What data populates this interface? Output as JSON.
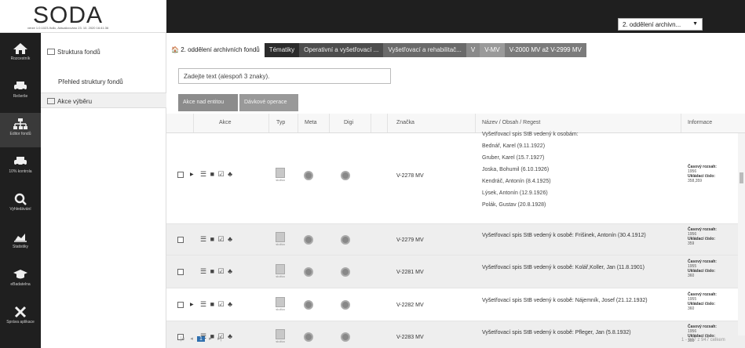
{
  "header": {
    "logo": "SODA",
    "version": "verze 1.0.1023-9c8c, Aktualizováno 23. 10. 2020 16:41:36",
    "dept_select": "2. oddělení archivn...",
    "dept_caret": "▼"
  },
  "rail": [
    {
      "label": "Rozcestník",
      "icon": "home-icon"
    },
    {
      "label": "Rešerše",
      "icon": "car-icon"
    },
    {
      "label": "Editor fondů",
      "icon": "hierarchy-icon"
    },
    {
      "label": "10% kontrola",
      "icon": "car-icon"
    },
    {
      "label": "Vyhledávání",
      "icon": "search-icon"
    },
    {
      "label": "Statistiky",
      "icon": "chart-icon"
    },
    {
      "label": "eBadatelna",
      "icon": "graduation-cap-icon"
    },
    {
      "label": "Správa aplikace",
      "icon": "wrench-icon"
    }
  ],
  "leftnav": {
    "structure": "Struktura fondů",
    "overview": "Přehled struktury fondů",
    "actions": "Akce výběru"
  },
  "tabs": [
    "2. oddělení archivních fondů",
    "Tématiky",
    "Operativní a vyšetřovací ...",
    "Vyšetřovací a rehabilitač...",
    "V",
    "V-MV",
    "V-2000 MV až V-2999 MV"
  ],
  "tab_home_glyph": "🏠",
  "filter": {
    "placeholder": "Zadejte text (alespoň 3 znaky)."
  },
  "toolbar": {
    "bulk": "Akce nad entitou",
    "ops": "Dávkové operace"
  },
  "columns": {
    "akce": "Akce",
    "typ": "Typ",
    "meta": "Meta",
    "digi": "Digi",
    "znacka": "Značka",
    "nazev": "Název / Obsah / Regest",
    "info": "Informace"
  },
  "rows": [
    {
      "expand": "▶",
      "actions": "☰ ■ ☑ ♣",
      "type_caption": "složka",
      "signature": "V-2278 MV",
      "names": [
        "Vyšetřovací spis StB vedený k osobám:",
        "Bednář, Karel (9.11.1922)",
        "Gruber, Karel (15.7.1927)",
        "Joska, Bohumil (6.10.1926)",
        "Kendráč, Antonín (8.4.1925)",
        "Lýsek, Antonín (12.9.1926)",
        "Polák, Gustav (20.8.1928)"
      ],
      "info_label1": "Časový rozsah:",
      "info_val1": "1956",
      "info_label2": "Ukládací číslo:",
      "info_val2": "358,359"
    },
    {
      "actions": "☰ ■ ☑ ♣",
      "type_caption": "složka",
      "signature": "V-2279 MV",
      "title": "Vyšetřovací spis StB vedený k osobě: Frišinek, Antonín (30.4.1912)",
      "info_label1": "Časový rozsah:",
      "info_val1": "1956",
      "info_label2": "Ukládací číslo:",
      "info_val2": "359"
    },
    {
      "actions": "☰ ■ ☑ ♣",
      "type_caption": "složka",
      "signature": "V-2281 MV",
      "title": "Vyšetřovací spis StB vedený k osobě: Kolář,Koller, Jan (11.8.1901)",
      "info_label1": "Časový rozsah:",
      "info_val1": "1955",
      "info_label2": "Ukládací číslo:",
      "info_val2": "360"
    },
    {
      "expand": "▶",
      "actions": "☰ ■ ☑ ♣",
      "type_caption": "složka",
      "signature": "V-2282 MV",
      "title": "Vyšetřovací spis StB vedený k osobě: Nájemník, Josef (21.12.1932)",
      "info_label1": "Časový rozsah:",
      "info_val1": "1955",
      "info_label2": "Ukládací číslo:",
      "info_val2": "360"
    },
    {
      "actions": "☰ ■ ☑ ♣",
      "type_caption": "složka",
      "signature": "V-2283 MV",
      "title": "Vyšetřovací spis StB vedený k osobě: Pfleger, Jan (5.8.1932)",
      "info_label1": "Časový rozsah:",
      "info_val1": "1956",
      "info_label2": "Ukládací číslo:",
      "info_val2": "360"
    }
  ],
  "pager": {
    "first": "|◂",
    "prev": "◂",
    "page": "1",
    "next": "▸",
    "last": "▸|"
  },
  "count": "1 - 947 z 947 celkem"
}
